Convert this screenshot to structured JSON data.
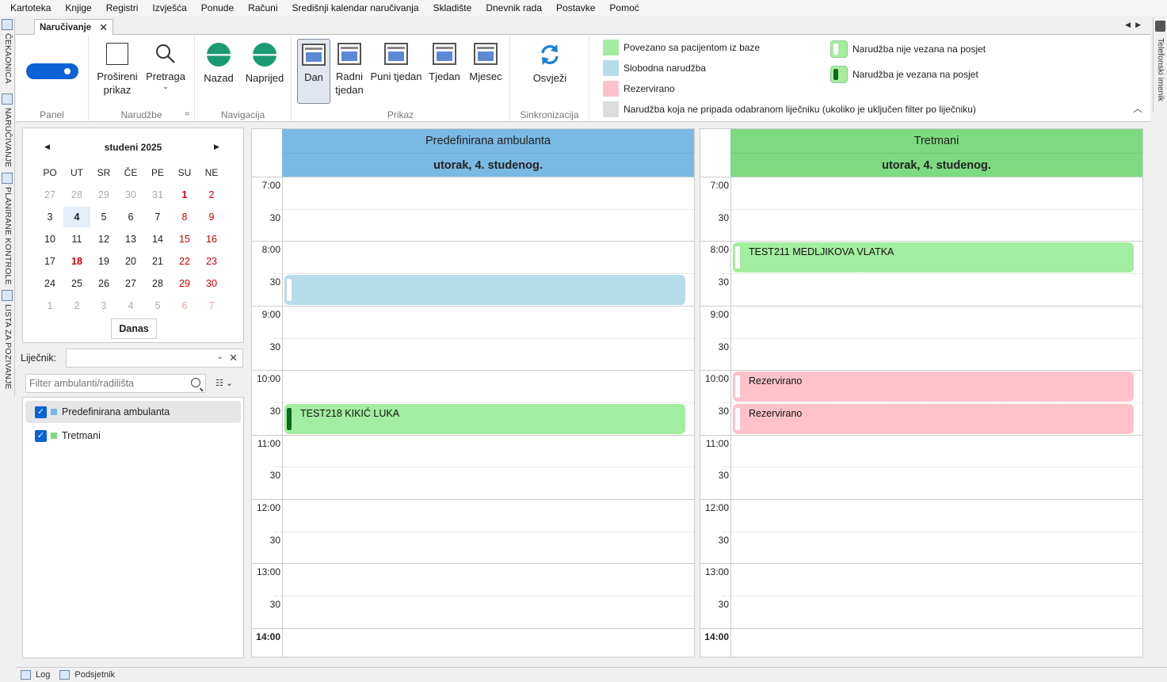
{
  "menu": [
    "Kartoteka",
    "Knjige",
    "Registri",
    "Izvješća",
    "Ponude",
    "Računi",
    "Središnji kalendar naručivanja",
    "Skladište",
    "Dnevnik rada",
    "Postavke",
    "Pomoć"
  ],
  "left_tabs": [
    "ČEKAONICA",
    "NARUČIVANJE",
    "PLANIRANE KONTROLE",
    "LISTA ZA POZIVANJE"
  ],
  "right_tab": "Telefonski imenik",
  "doc_tab": {
    "label": "Naručivanje",
    "close": "✕"
  },
  "ribbon": {
    "groups": {
      "panel": "Panel",
      "narudzbe": "Narudžbe",
      "navigacija": "Navigacija",
      "prikaz": "Prikaz",
      "sinkronizacija": "Sinkronizacija"
    },
    "buttons": {
      "prosireni": "Prošireni prikaz",
      "pretraga": "Pretraga",
      "nazad": "Nazad",
      "naprijed": "Naprijed",
      "dan": "Dan",
      "radni_tjedan": "Radni tjedan",
      "puni_tjedan": "Puni tjedan",
      "tjedan": "Tjedan",
      "mjesec": "Mjesec",
      "osvjezi": "Osvježi"
    },
    "legend": [
      {
        "label": "Povezano sa pacijentom iz baze",
        "color": "#a3eda0"
      },
      {
        "label": "Slobodna narudžba",
        "color": "#b6dbea"
      },
      {
        "label": "Rezervirano",
        "color": "#ffc2cb"
      },
      {
        "label": "Narudžba koja ne pripada odabranom liječniku (ukoliko je uključen filter po liječniku)",
        "color": "#dcdcdc"
      },
      {
        "label": "Narudžba nije vezana na posjet",
        "color": "#ffffff"
      },
      {
        "label": "Narudžba je vezana na posjet",
        "color": "#0b6b1d"
      }
    ]
  },
  "calendar": {
    "month": "studeni 2025",
    "weekdays": [
      "PO",
      "UT",
      "SR",
      "ČE",
      "PE",
      "SU",
      "NE"
    ],
    "weeks": [
      [
        "27",
        "28",
        "29",
        "30",
        "31",
        "1",
        "2"
      ],
      [
        "3",
        "4",
        "5",
        "6",
        "7",
        "8",
        "9"
      ],
      [
        "10",
        "11",
        "12",
        "13",
        "14",
        "15",
        "16"
      ],
      [
        "17",
        "18",
        "19",
        "20",
        "21",
        "22",
        "23"
      ],
      [
        "24",
        "25",
        "26",
        "27",
        "28",
        "29",
        "30"
      ],
      [
        "1",
        "2",
        "3",
        "4",
        "5",
        "6",
        "7"
      ]
    ],
    "today_button": "Danas"
  },
  "doctor_label": "Liječnik:",
  "filter_placeholder": "Filter ambulanti/radilišta",
  "resources": [
    {
      "label": "Predefinirana ambulanta",
      "color": "#7ab9e3"
    },
    {
      "label": "Tretmani",
      "color": "#7dda80"
    }
  ],
  "schedules": [
    {
      "title": "Predefinirana ambulanta",
      "date": "utorak, 4. studenog.",
      "color": "#7ab9e3",
      "times": [
        "7:00",
        "30",
        "8:00",
        "30",
        "9:00",
        "30",
        "10:00",
        "30",
        "11:00",
        "30",
        "12:00",
        "30",
        "13:00",
        "30",
        "14:00"
      ],
      "appointments": [
        {
          "text": "",
          "color": "#b6dbea",
          "strip": "#ffffff"
        },
        {
          "text": "TEST218 KIKIĆ LUKA",
          "color": "#a3eda0",
          "strip": "#0b6b1d"
        }
      ]
    },
    {
      "title": "Tretmani",
      "date": "utorak, 4. studenog.",
      "color": "#7dda80",
      "times": [
        "7:00",
        "30",
        "8:00",
        "30",
        "9:00",
        "30",
        "10:00",
        "30",
        "11:00",
        "30",
        "12:00",
        "30",
        "13:00",
        "30",
        "14:00"
      ],
      "appointments": [
        {
          "text": "TEST211 MEDLJIKOVA VLATKA",
          "color": "#a3eda0",
          "strip": "#ffffff"
        },
        {
          "text": "Rezervirano",
          "color": "#ffc2cb",
          "strip": "#ffffff"
        },
        {
          "text": "Rezervirano",
          "color": "#ffc2cb",
          "strip": "#ffffff"
        }
      ]
    }
  ],
  "bottom_tabs": [
    "Log",
    "Podsjetnik"
  ]
}
